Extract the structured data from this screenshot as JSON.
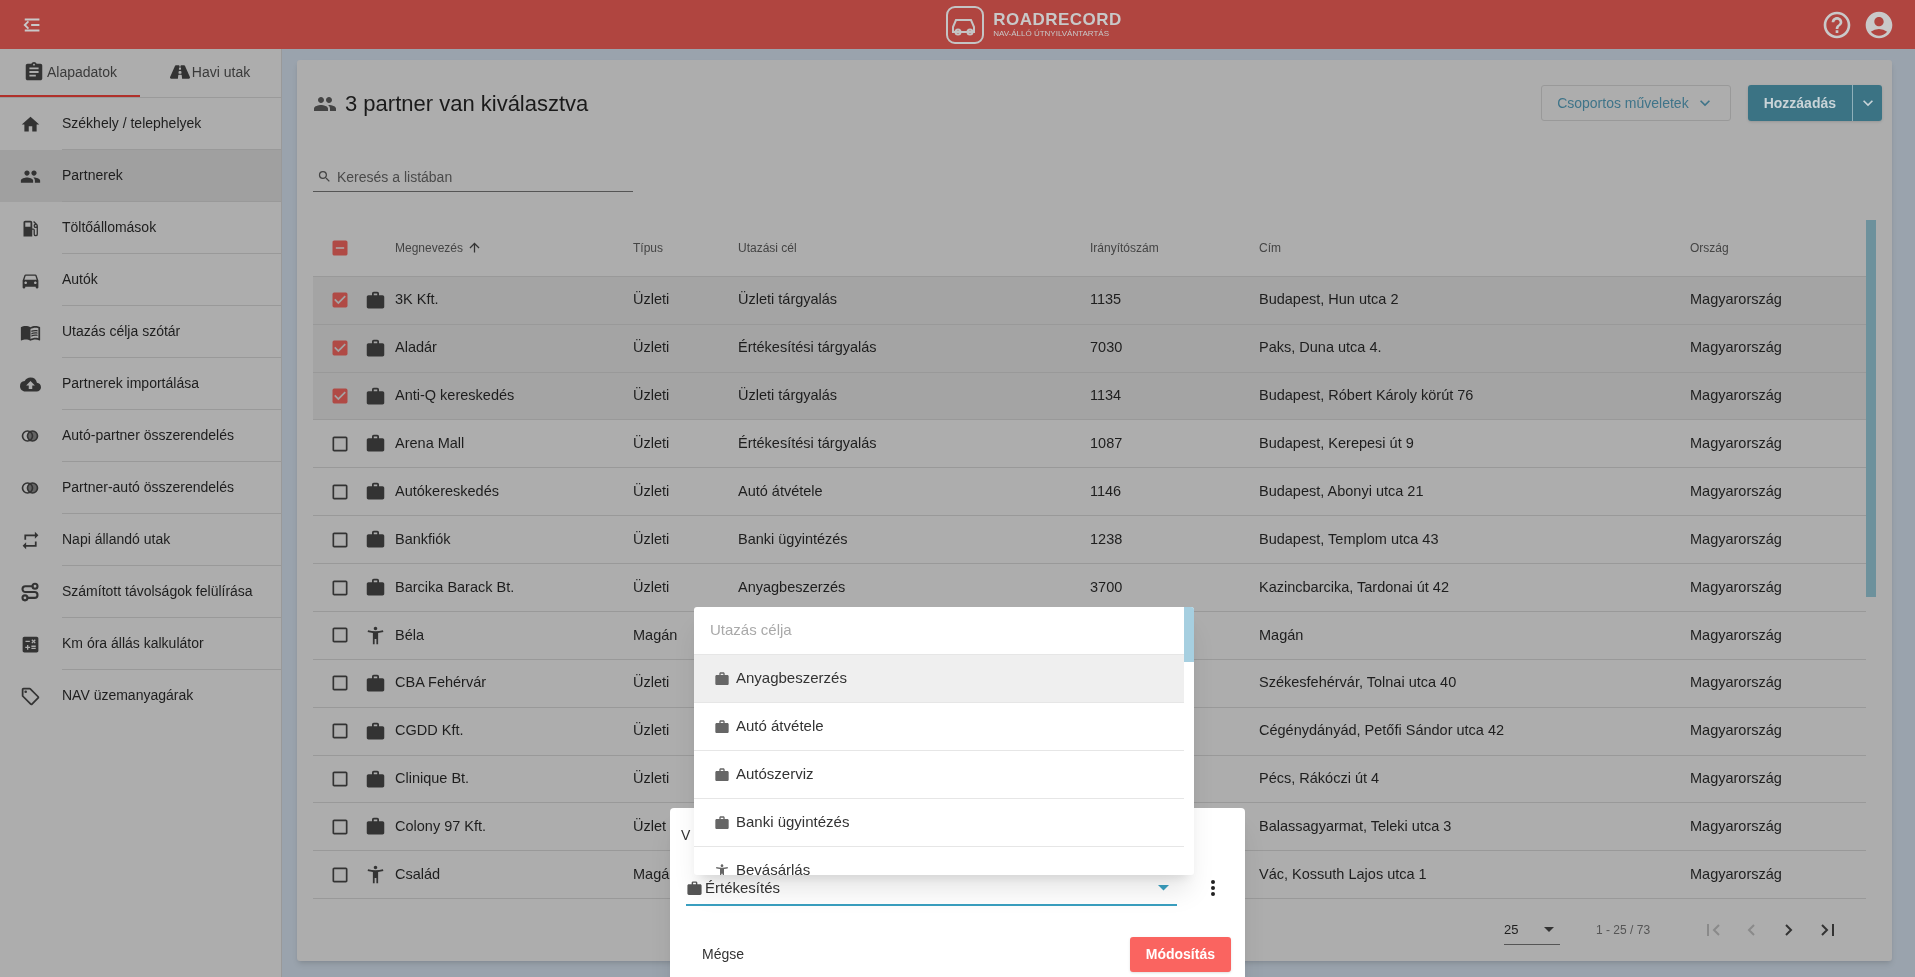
{
  "header": {
    "logo_title": "ROADRECORD",
    "logo_subtitle": "NAV-ÁLLÓ ÚTNYILVÁNTARTÁS"
  },
  "sidebar": {
    "tabs": [
      {
        "label": "Alapadatok",
        "selected": true
      },
      {
        "label": "Havi utak",
        "selected": false
      }
    ],
    "items": [
      {
        "label": "Székhely / telephelyek",
        "selected": false
      },
      {
        "label": "Partnerek",
        "selected": true
      },
      {
        "label": "Töltőállomások",
        "selected": false
      },
      {
        "label": "Autók",
        "selected": false
      },
      {
        "label": "Utazás célja szótár",
        "selected": false
      },
      {
        "label": "Partnerek importálása",
        "selected": false
      },
      {
        "label": "Autó-partner összerendelés",
        "selected": false
      },
      {
        "label": "Partner-autó összerendelés",
        "selected": false
      },
      {
        "label": "Napi állandó utak",
        "selected": false
      },
      {
        "label": "Számított távolságok felülírása",
        "selected": false
      },
      {
        "label": "Km óra állás kalkulátor",
        "selected": false
      },
      {
        "label": "NAV üzemanyagárak",
        "selected": false
      }
    ]
  },
  "page": {
    "title": "3 partner van kiválasztva",
    "search": {
      "placeholder": "Keresés a listában"
    },
    "bulk_button": "Csoportos műveletek",
    "add_button": "Hozzáadás"
  },
  "table": {
    "select_all": {
      "indeterminate": true
    },
    "columns": [
      {
        "label": "Megnevezés",
        "sorted": true
      },
      {
        "label": "Típus",
        "sorted": false
      },
      {
        "label": "Utazási cél",
        "sorted": false
      },
      {
        "label": "Irányítószám",
        "sorted": false
      },
      {
        "label": "Cím",
        "sorted": false
      },
      {
        "label": "Ország",
        "sorted": false
      }
    ],
    "rows": [
      {
        "checked": true,
        "kind": "business",
        "name": "3K Kft.",
        "type": "Üzleti",
        "purpose": "Üzleti tárgyalás",
        "zip": "1135",
        "address": "Budapest, Hun utca 2",
        "country": "Magyarország"
      },
      {
        "checked": true,
        "kind": "business",
        "name": "Aladár",
        "type": "Üzleti",
        "purpose": "Értékesítési tárgyalás",
        "zip": "7030",
        "address": "Paks, Duna utca 4.",
        "country": "Magyarország"
      },
      {
        "checked": true,
        "kind": "business",
        "name": "Anti-Q kereskedés",
        "type": "Üzleti",
        "purpose": "Üzleti tárgyalás",
        "zip": "1134",
        "address": "Budapest, Róbert Károly körút 76",
        "country": "Magyarország"
      },
      {
        "checked": false,
        "kind": "business",
        "name": "Arena Mall",
        "type": "Üzleti",
        "purpose": "Értékesítési tárgyalás",
        "zip": "1087",
        "address": "Budapest, Kerepesi út 9",
        "country": "Magyarország"
      },
      {
        "checked": false,
        "kind": "business",
        "name": "Autókereskedés",
        "type": "Üzleti",
        "purpose": "Autó átvétele",
        "zip": "1146",
        "address": "Budapest, Abonyi utca 21",
        "country": "Magyarország"
      },
      {
        "checked": false,
        "kind": "business",
        "name": "Bankfiók",
        "type": "Üzleti",
        "purpose": "Banki ügyintézés",
        "zip": "1238",
        "address": "Budapest, Templom utca 43",
        "country": "Magyarország"
      },
      {
        "checked": false,
        "kind": "business",
        "name": "Barcika Barack Bt.",
        "type": "Üzleti",
        "purpose": "Anyagbeszerzés",
        "zip": "3700",
        "address": "Kazincbarcika, Tardonai út 42",
        "country": "Magyarország"
      },
      {
        "checked": false,
        "kind": "private",
        "name": "Béla",
        "type": "Magán",
        "address": "Magán",
        "country": "Magyarország"
      },
      {
        "checked": false,
        "kind": "business",
        "name": "CBA Fehérvár",
        "type": "Üzleti",
        "address": "Székesfehérvár, Tolnai utca 40",
        "country": "Magyarország"
      },
      {
        "checked": false,
        "kind": "business",
        "name": "CGDD Kft.",
        "type": "Üzleti",
        "address": "Cégénydányád, Petőfi Sándor utca 42",
        "country": "Magyarország"
      },
      {
        "checked": false,
        "kind": "business",
        "name": "Clinique Bt.",
        "type": "Üzleti",
        "address": "Pécs, Rákóczi út 4",
        "country": "Magyarország"
      },
      {
        "checked": false,
        "kind": "business",
        "name": "Colony 97 Kft.",
        "type": "Üzlet",
        "address": "Balassagyarmat, Teleki utca 3",
        "country": "Magyarország"
      },
      {
        "checked": false,
        "kind": "private",
        "name": "Család",
        "type": "Magá",
        "address": "Vác, Kossuth Lajos utca 1",
        "country": "Magyarország"
      }
    ]
  },
  "pagination": {
    "page_size": "25",
    "range": "1 - 25 / 73",
    "first_disabled": true,
    "prev_disabled": true,
    "next_disabled": false,
    "last_disabled": false
  },
  "dialog": {
    "title": "V",
    "field": {
      "kind": "business",
      "value": "Értékesítés"
    },
    "cancel_button": "Mégse",
    "submit_button": "Módosítás"
  },
  "dropdown": {
    "placeholder": "Utazás célja",
    "options": [
      {
        "label": "Anyagbeszerzés",
        "kind": "business",
        "selected": true
      },
      {
        "label": "Autó átvétele",
        "kind": "business",
        "selected": false
      },
      {
        "label": "Autószerviz",
        "kind": "business",
        "selected": false
      },
      {
        "label": "Banki ügyintézés",
        "kind": "business",
        "selected": false
      },
      {
        "label": "Bevásárlás",
        "kind": "private",
        "selected": false
      }
    ]
  }
}
